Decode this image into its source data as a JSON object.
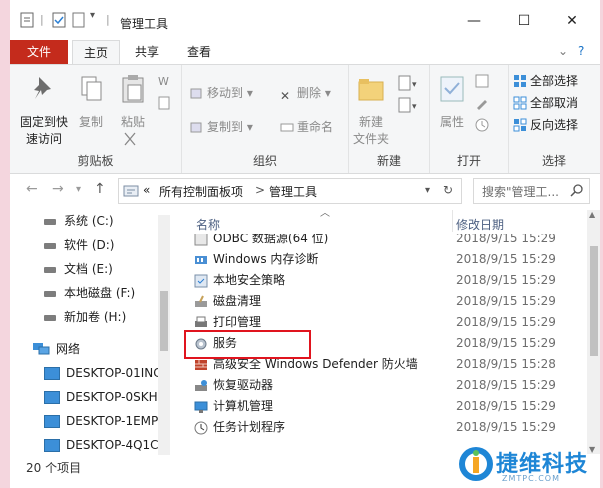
{
  "window": {
    "title": "管理工具",
    "min_glyph": "—",
    "max_glyph": "☐",
    "close_glyph": "✕"
  },
  "tabs": {
    "file": "文件",
    "home": "主页",
    "share": "共享",
    "view": "查看"
  },
  "ribbon": {
    "pin": "固定到快\n速访问",
    "copy": "复制",
    "paste": "粘贴",
    "clipboard_label": "剪贴板",
    "move_to": "移动到",
    "copy_to": "复制到",
    "delete": "删除",
    "rename": "重命名",
    "organize_label": "组织",
    "new_folder": "新建\n文件夹",
    "new_label": "新建",
    "properties": "属性",
    "open_label": "打开",
    "select_all": "全部选择",
    "select_none": "全部取消",
    "invert_selection": "反向选择",
    "select_label": "选择"
  },
  "address": {
    "overflow": "«",
    "crumbs": [
      "所有控制面板项",
      "管理工具"
    ],
    "search_placeholder": "搜索\"管理工..."
  },
  "nav_pane": {
    "drives": [
      {
        "label": "系统 (C:)"
      },
      {
        "label": "软件 (D:)"
      },
      {
        "label": "文档 (E:)"
      },
      {
        "label": "本地磁盘 (F:)"
      },
      {
        "label": "新加卷 (H:)"
      }
    ],
    "network": "网络",
    "computers": [
      {
        "label": "DESKTOP-01INC"
      },
      {
        "label": "DESKTOP-0SKH-"
      },
      {
        "label": "DESKTOP-1EMP"
      },
      {
        "label": "DESKTOP-4Q1C"
      }
    ]
  },
  "columns": {
    "name": "名称",
    "modified": "修改日期"
  },
  "files": [
    {
      "name": "ODBC 数据源(64 位)",
      "date": "2018/9/15 15:29"
    },
    {
      "name": "Windows 内存诊断",
      "date": "2018/9/15 15:29"
    },
    {
      "name": "本地安全策略",
      "date": "2018/9/15 15:29"
    },
    {
      "name": "磁盘清理",
      "date": "2018/9/15 15:29"
    },
    {
      "name": "打印管理",
      "date": "2018/9/15 15:29"
    },
    {
      "name": "服务",
      "date": "2018/9/15 15:29"
    },
    {
      "name": "高级安全 Windows Defender 防火墙",
      "date": "2018/9/15 15:28"
    },
    {
      "name": "恢复驱动器",
      "date": "2018/9/15 15:29"
    },
    {
      "name": "计算机管理",
      "date": "2018/9/15 15:29"
    },
    {
      "name": "任务计划程序",
      "date": "2018/9/15 15:29"
    }
  ],
  "status": {
    "count": "20 个项目"
  },
  "watermark": {
    "text": "捷维科技",
    "sub": "ZMTPC.COM"
  }
}
